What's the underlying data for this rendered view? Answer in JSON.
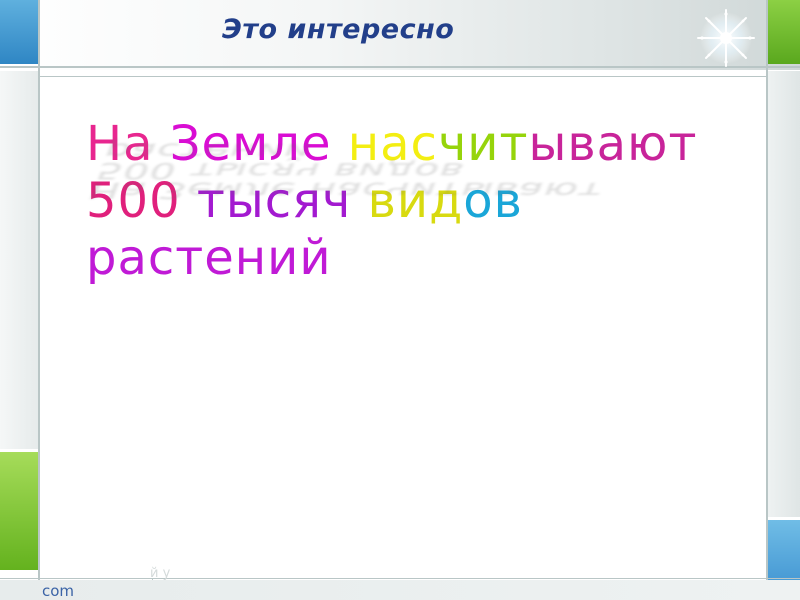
{
  "slide": {
    "title": "Это интересно",
    "footer_text": "com",
    "footer_faint": "й у",
    "content_lines": [
      {
        "segments": [
          {
            "text": "На ",
            "color": "#e8268f"
          },
          {
            "text": "Земле ",
            "color": "#d90dd3"
          },
          {
            "text": "нас",
            "color": "#f3ee12"
          },
          {
            "text": "чит",
            "color": "#96d40b"
          },
          {
            "text": "ывают",
            "color": "#c8249a"
          }
        ]
      },
      {
        "segments": [
          {
            "text": "500 ",
            "color": "#e0207c"
          },
          {
            "text": "тысяч ",
            "color": "#a31ad0"
          },
          {
            "text": "вид",
            "color": "#d8da10"
          },
          {
            "text": "ов",
            "color": "#1aa6d8"
          }
        ]
      },
      {
        "segments": [
          {
            "text": "растений",
            "color": "#c01ad6"
          }
        ]
      }
    ]
  },
  "colors": {
    "title": "#223f8a",
    "accent_blue": "#2f86c4",
    "accent_green": "#64b21e"
  }
}
